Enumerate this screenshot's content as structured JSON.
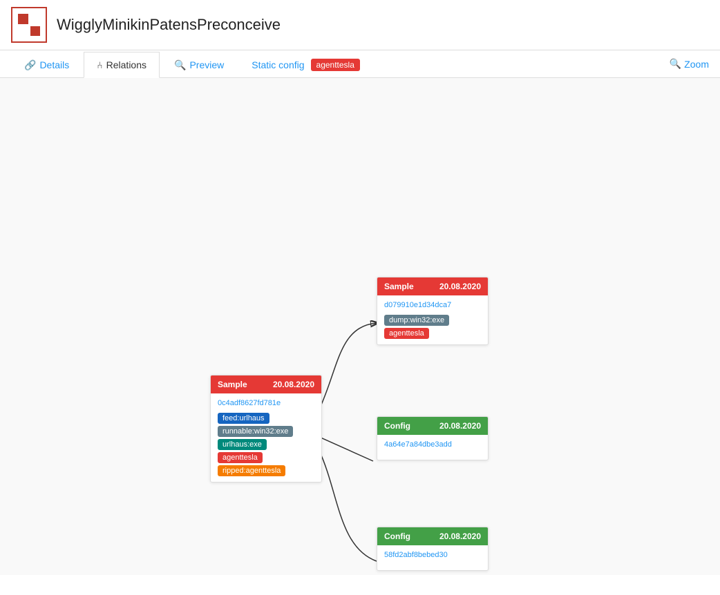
{
  "app": {
    "title": "WigglyMinikinPatensPreconceive"
  },
  "tabs": [
    {
      "id": "details",
      "label": "Details",
      "icon": "wifi",
      "active": false
    },
    {
      "id": "relations",
      "label": "Relations",
      "icon": "hierarchy",
      "active": true
    },
    {
      "id": "preview",
      "label": "Preview",
      "icon": "search",
      "active": false
    },
    {
      "id": "static-config",
      "label": "Static config",
      "icon": "",
      "active": false,
      "badge": "agenttesla"
    }
  ],
  "zoom_label": "Zoom",
  "nodes": {
    "left_sample": {
      "type": "Sample",
      "date": "20.08.2020",
      "hash": "0c4adf8627fd781e",
      "tags": [
        {
          "label": "feed:urlhaus",
          "color": "blue"
        },
        {
          "label": "runnable:win32:exe",
          "color": "gray"
        },
        {
          "label": "urlhaus:exe",
          "color": "teal"
        },
        {
          "label": "agenttesla",
          "color": "red"
        },
        {
          "label": "ripped:agenttesla",
          "color": "orange"
        }
      ]
    },
    "top_right_sample": {
      "type": "Sample",
      "date": "20.08.2020",
      "hash": "d079910e1d34dca7",
      "tags": [
        {
          "label": "dump:win32:exe",
          "color": "gray"
        },
        {
          "label": "agenttesla",
          "color": "red"
        }
      ]
    },
    "mid_right_config": {
      "type": "Config",
      "date": "20.08.2020",
      "hash": "4a64e7a84dbe3add",
      "tags": []
    },
    "bot_right_config": {
      "type": "Config",
      "date": "20.08.2020",
      "hash": "58fd2abf8bebed30",
      "tags": []
    }
  }
}
